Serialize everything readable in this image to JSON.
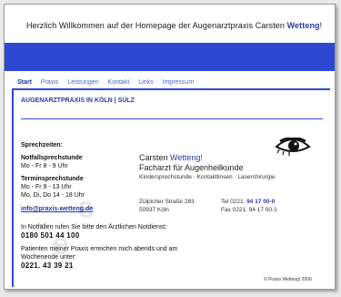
{
  "header": {
    "prefix": "Herzlich Willkommen auf der Homepage der Augenarztpraxis Carsten ",
    "highlight": "Wetteng",
    "suffix": "!"
  },
  "nav": [
    "Start",
    "Praxis",
    "Leistungen",
    "Kontakt",
    "Links",
    "Impressum"
  ],
  "section_title": "AUGENARZTPRAXIS IN KÖLN | SÜLZ",
  "hours": {
    "title": "Sprechzeiten:",
    "emergency_title": "Notfallsprechstunde",
    "emergency_hours": "Mo - Fr 8 - 9 Uhr",
    "appointment_title": "Terminsprechstunde",
    "appointment_hours_1": "Mo - Fr 9 - 13 Uhr",
    "appointment_hours_2": "Mo, Di, Do 14 - 18 Uhr",
    "email": "info@praxis-wetteng.de"
  },
  "doctor": {
    "name_prefix": "Carsten ",
    "name_highlight": "Wetteng!",
    "title": "Facharzt für Augenheilkunde",
    "services": "Kindersprechstunde · Kontaktlinsen · Laserchirurgie"
  },
  "address": {
    "street": "Zülpicher Straße 283",
    "city": "50937 Köln"
  },
  "contact": {
    "tel_label": "Tel 0221. ",
    "tel_number": "94 17 00-0",
    "fax_label": "Fax 0221. ",
    "fax_number": "94 17 00-1"
  },
  "emergency": {
    "text": "In Notfällen rufen Sie bitte den Ärztlichen Notdienst:",
    "number": "0180 501 44 100",
    "evening_1": "Patienten meiner Praxis erreichen mich abends und am",
    "evening_2": "Wochenende unter:",
    "evening_number": "0221. 43 39 21"
  },
  "copyright": "© Praxis Wetteng! 2006",
  "colors": {
    "accent": "#2e48d2",
    "link": "#4a6ac8"
  }
}
